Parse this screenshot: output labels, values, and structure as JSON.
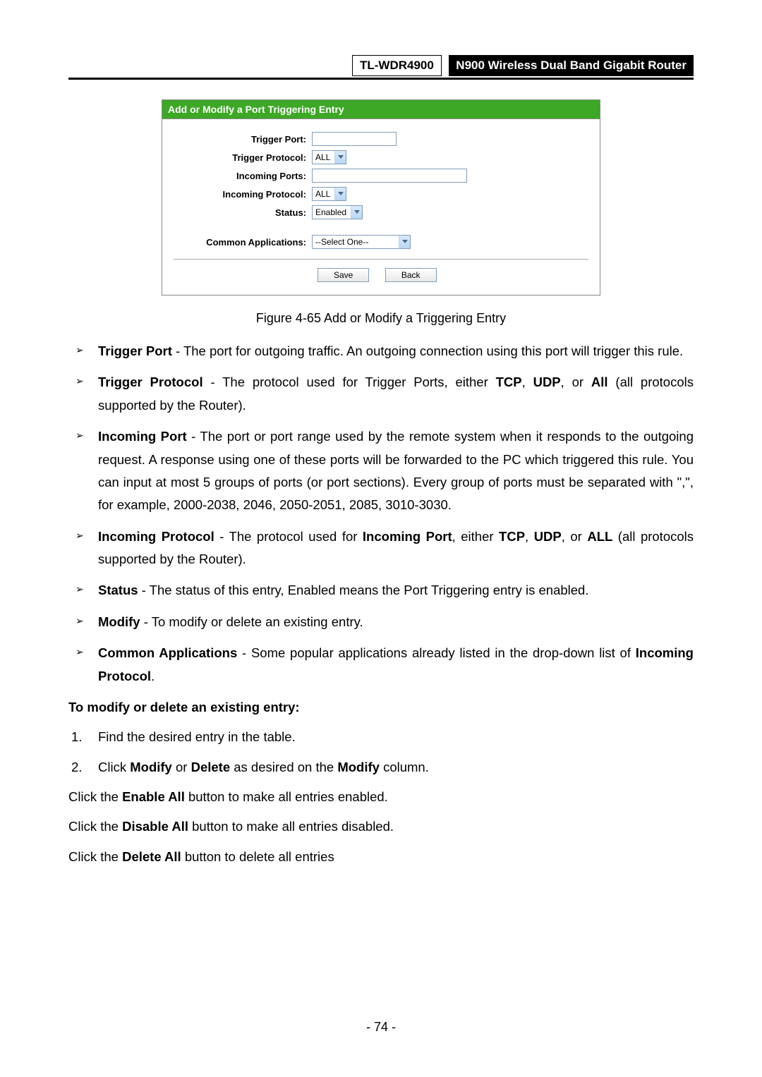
{
  "header": {
    "model": "TL-WDR4900",
    "title": "N900 Wireless Dual Band Gigabit Router"
  },
  "panel": {
    "title": "Add or Modify a Port Triggering Entry",
    "labels": {
      "trigger_port": "Trigger Port:",
      "trigger_protocol": "Trigger Protocol:",
      "incoming_ports": "Incoming Ports:",
      "incoming_protocol": "Incoming Protocol:",
      "status": "Status:",
      "common_apps": "Common Applications:"
    },
    "values": {
      "trigger_port": "",
      "trigger_protocol": "ALL",
      "incoming_ports": "",
      "incoming_protocol": "ALL",
      "status": "Enabled",
      "common_apps": "--Select One--"
    },
    "buttons": {
      "save": "Save",
      "back": "Back"
    }
  },
  "caption": "Figure 4-65 Add or Modify a Triggering Entry",
  "bullets": {
    "b1_lead": "Trigger Port",
    "b1_rest": " - The port for outgoing traffic. An outgoing connection using this port will trigger this rule.",
    "b2_lead": "Trigger Protocol",
    "b2_mid": " - The protocol used for Trigger Ports, either ",
    "b2_tcp": "TCP",
    "b2_udp": "UDP",
    "b2_all": "All",
    "b2_end": " (all protocols supported by the Router).",
    "b3_lead": "Incoming Port",
    "b3_rest": " - The port or port range used by the remote system when it responds to the outgoing request. A response using one of these ports will be forwarded to the PC which triggered this rule. You can input at most 5 groups of ports (or port sections). Every group of ports must be separated with \",\", for example, 2000-2038, 2046, 2050-2051, 2085, 3010-3030.",
    "b4_lead": "Incoming Protocol",
    "b4_mid": " - The protocol used for ",
    "b4_ip": "Incoming Port",
    "b4_either": ", either ",
    "b4_tcp": "TCP",
    "b4_udp": "UDP",
    "b4_all": "ALL",
    "b4_end": " (all protocols supported by the Router).",
    "b5_lead": "Status",
    "b5_rest": " - The status of this entry, Enabled means the Port Triggering entry is enabled.",
    "b6_lead": "Modify",
    "b6_rest": " - To modify or delete an existing entry.",
    "b7_lead": "Common Applications",
    "b7_mid": " - Some popular applications already listed in the drop-down list of ",
    "b7_ip": "Incoming Protocol",
    "b7_end": "."
  },
  "subhead": "To modify or delete an existing entry:",
  "ol": {
    "n1": "1.",
    "i1": "Find the desired entry in the table.",
    "n2": "2.",
    "i2_a": "Click ",
    "i2_m": "Modify",
    "i2_b": " or ",
    "i2_d": "Delete",
    "i2_c": " as desired on the ",
    "i2_mc": "Modify",
    "i2_e": " column."
  },
  "paras": {
    "p1a": "Click the ",
    "p1b": "Enable All",
    "p1c": " button to make all entries enabled.",
    "p2a": "Click the ",
    "p2b": "Disable All",
    "p2c": " button to make all entries disabled.",
    "p3a": "Click the ",
    "p3b": "Delete All",
    "p3c": " button to delete all entries"
  },
  "page": "- 74 -"
}
